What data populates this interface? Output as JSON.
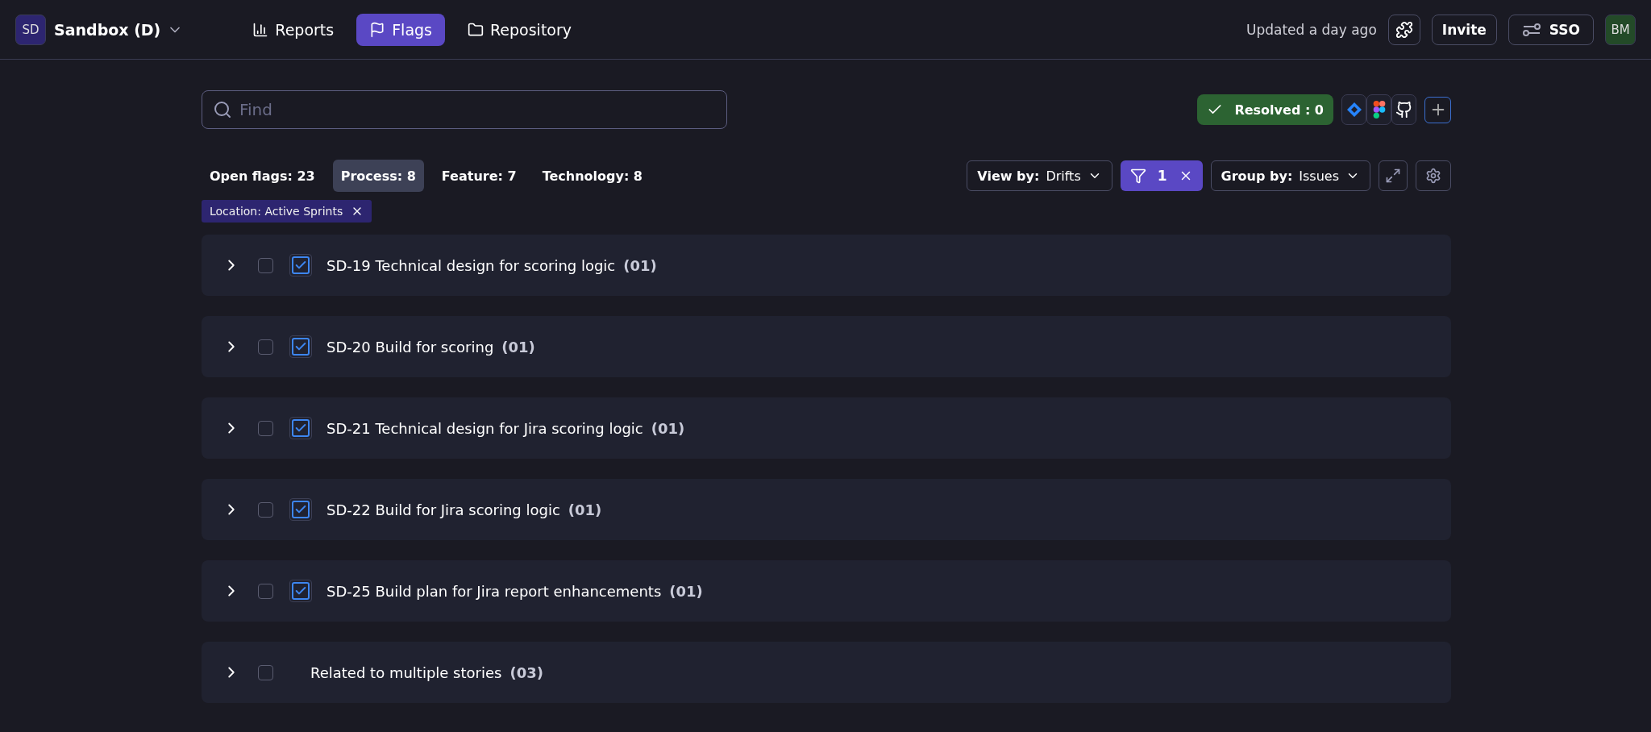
{
  "workspace": {
    "initials": "SD",
    "name": "Sandbox (D)"
  },
  "nav": [
    {
      "label": "Reports",
      "selected": false
    },
    {
      "label": "Flags",
      "selected": true
    },
    {
      "label": "Repository",
      "selected": false
    }
  ],
  "header_right": {
    "updated": "Updated a day ago",
    "invite": "Invite",
    "sso": "SSO",
    "avatar": "BM"
  },
  "search": {
    "placeholder": "Find"
  },
  "resolved": "Resolved : 0",
  "tabs": [
    {
      "label": "Open flags: 23",
      "selected": false
    },
    {
      "label": "Process: 8",
      "selected": true
    },
    {
      "label": "Feature: 7",
      "selected": false
    },
    {
      "label": "Technology: 8",
      "selected": false
    }
  ],
  "view_by": {
    "label": "View by:",
    "value": "Drifts"
  },
  "filter_count": "1",
  "group_by": {
    "label": "Group by:",
    "value": "Issues"
  },
  "chips": [
    "Location: Active Sprints"
  ],
  "rows": [
    {
      "kind": "story",
      "title": "SD-19 Technical design for scoring logic",
      "count": "(01)",
      "checked": false
    },
    {
      "kind": "story",
      "title": "SD-20 Build for scoring",
      "count": "(01)",
      "checked": false
    },
    {
      "kind": "story",
      "title": "SD-21 Technical design for Jira scoring logic",
      "count": "(01)",
      "checked": false
    },
    {
      "kind": "story",
      "title": "SD-22 Build for Jira scoring logic",
      "count": "(01)",
      "checked": false
    },
    {
      "kind": "story",
      "title": "SD-25 Build plan for Jira report enhancements",
      "count": "(01)",
      "checked": false
    },
    {
      "kind": "group",
      "title": "Related to multiple stories",
      "count": "(03)",
      "checked": false
    }
  ]
}
